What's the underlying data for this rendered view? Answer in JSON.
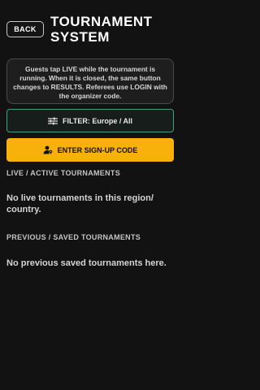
{
  "header": {
    "back_label": "BACK",
    "title": "TOURNAMENT SYSTEM"
  },
  "info": {
    "text": "Guests tap LIVE while the tournament is running. When it is closed, the same button changes to RESULTS. Referees use LOGIN with the organizer code."
  },
  "filter": {
    "icon": "sliders-icon",
    "label": "FILTER: Europe / All"
  },
  "signup": {
    "icon": "user-key-icon",
    "label": "ENTER SIGN-UP CODE"
  },
  "live": {
    "heading": "LIVE / ACTIVE TOURNAMENTS",
    "empty": "No live tournaments in this region/ country."
  },
  "previous": {
    "heading": "PREVIOUS / SAVED TOURNAMENTS",
    "empty": "No previous saved tournaments here."
  },
  "colors": {
    "background": "#121212",
    "accent_green": "#39a37f",
    "accent_yellow": "#f8b10a"
  }
}
